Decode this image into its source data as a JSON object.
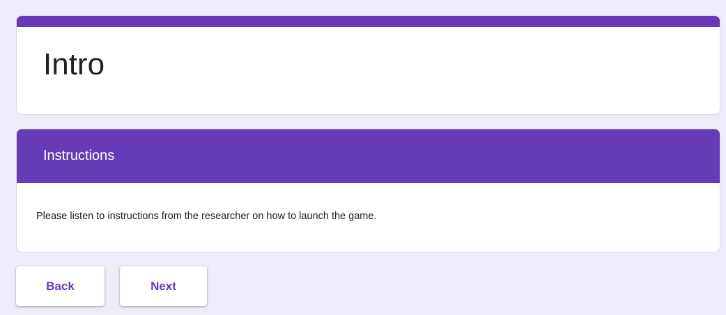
{
  "form": {
    "title": "Intro"
  },
  "section": {
    "title": "Instructions",
    "description": "Please listen to instructions from the researcher on how to launch the game."
  },
  "navigation": {
    "back_label": "Back",
    "next_label": "Next"
  },
  "colors": {
    "accent": "#673ab7",
    "background": "#f0ebf8",
    "card": "#ffffff"
  }
}
